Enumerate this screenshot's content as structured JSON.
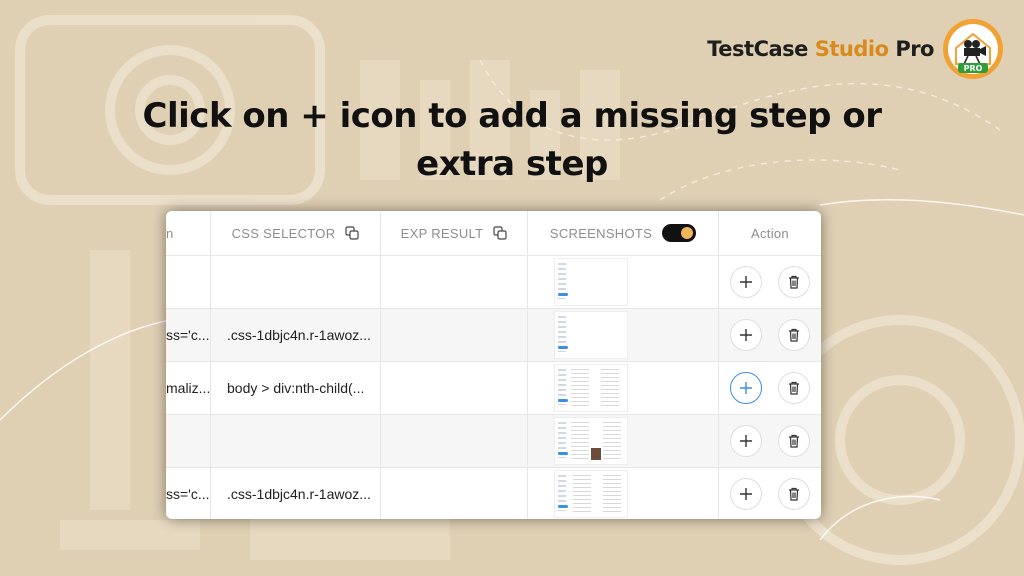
{
  "brand": {
    "name_part1": "TestCase",
    "name_part2": "Studio",
    "name_part3": "Pro",
    "logo_badge": "PRO",
    "accent_color": "#d88a1d"
  },
  "headline": {
    "line1": "Click on + icon to add a missing step or",
    "line2": "extra step"
  },
  "table": {
    "headers": {
      "first_partial": "n",
      "css_selector": "CSS SELECTOR",
      "exp_result": "EXP RESULT",
      "screenshots": "SCREENSHOTS",
      "action": "Action"
    },
    "screenshots_toggle_on": true,
    "rows": [
      {
        "first": "",
        "css": "",
        "exp": "",
        "has_screenshot": true,
        "plus_highlighted": false
      },
      {
        "first": "ss='c...",
        "css": ".css-1dbjc4n.r-1awoz...",
        "exp": "",
        "has_screenshot": true,
        "plus_highlighted": false
      },
      {
        "first": "maliz...",
        "css": "body > div:nth-child(...",
        "exp": "",
        "has_screenshot": true,
        "plus_highlighted": true
      },
      {
        "first": "",
        "css": "",
        "exp": "",
        "has_screenshot": true,
        "plus_highlighted": false
      },
      {
        "first": "ss='c...",
        "css": ".css-1dbjc4n.r-1awoz...",
        "exp": "",
        "has_screenshot": true,
        "plus_highlighted": false
      }
    ]
  },
  "icons": {
    "copy": "copy-icon",
    "add": "plus-icon",
    "delete": "trash-icon",
    "logo": "movie-camera-house-icon"
  },
  "colors": {
    "background": "#dfd0b4",
    "highlight_blue": "#3a8ee6",
    "toggle_knob": "#f2b35d"
  }
}
